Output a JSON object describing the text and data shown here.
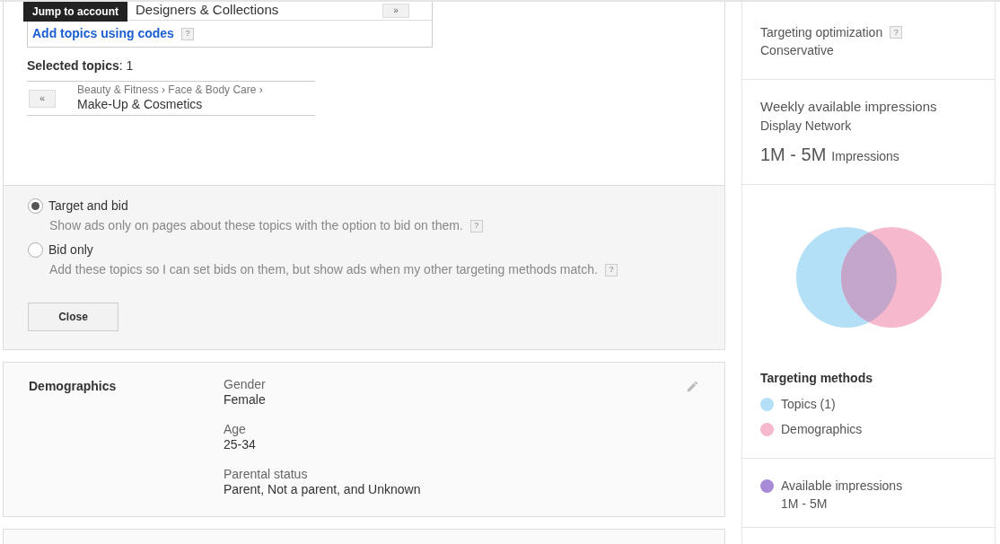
{
  "tooltip": "Jump to account",
  "topic_search": {
    "result": "Designers & Collections",
    "add_button": "»",
    "codes_link": "Add topics using codes",
    "help": "?"
  },
  "selected_topics": {
    "label": "**Selected topics**: 1",
    "items": [
      {
        "remove": "«",
        "path": "Beauty & Fitness › Face & Body Care ›",
        "name": "Make-Up & Cosmetics"
      }
    ]
  },
  "targeting_options": [
    {
      "label": "Target and bid",
      "description": "Show ads only on pages about these topics with the option to bid on them.",
      "help": "?",
      "selected": true
    },
    {
      "label": "Bid only",
      "description": "Add these topics so I can set bids on them, but show ads when my other targeting methods match.",
      "help": "?",
      "selected": false
    }
  ],
  "close_button": "Close",
  "demographics": {
    "title": "Demographics",
    "fields": [
      {
        "label": "Gender",
        "value": "Female"
      },
      {
        "label": "Age",
        "value": "25-34"
      },
      {
        "label": "Parental status",
        "value": "Parent, Not a parent, and Unknown"
      }
    ]
  },
  "sidebar": {
    "optimization": {
      "label": "Targeting optimization",
      "help": "?",
      "value": "Conservative"
    },
    "weekly": {
      "title": "Weekly available impressions",
      "network": "Display Network",
      "range": "1M - 5M",
      "unit": "Impressions"
    },
    "methods": {
      "title": "Targeting methods",
      "items": [
        {
          "label": "Topics (1)",
          "color": "#b3e0f7"
        },
        {
          "label": "Demographics",
          "color": "#f5b8cc"
        }
      ]
    },
    "available": {
      "label": "Available impressions",
      "value": "1M - 5M",
      "color": "#a88bd6"
    }
  }
}
